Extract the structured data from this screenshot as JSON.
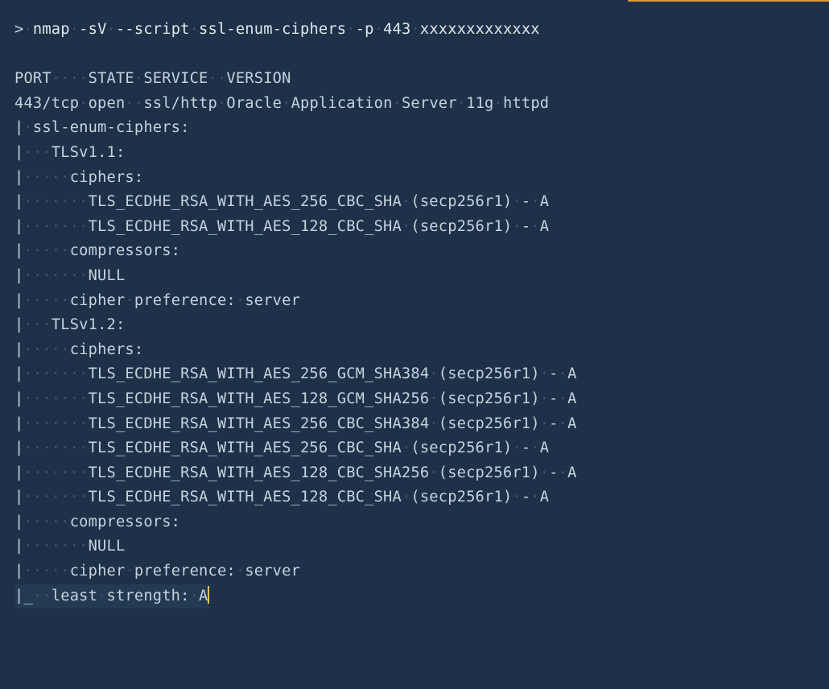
{
  "terminal": {
    "prompt": ">",
    "command": "nmap -sV --script ssl-enum-ciphers -p 443 xxxxxxxxxxxxx",
    "header": "PORT    STATE SERVICE  VERSION",
    "port_line": "443/tcp open  ssl/http Oracle Application Server 11g httpd",
    "script_name": "ssl-enum-ciphers:",
    "tls11": {
      "label": "TLSv1.1:",
      "ciphers_label": "ciphers:",
      "ciphers": [
        "TLS_ECDHE_RSA_WITH_AES_256_CBC_SHA (secp256r1) - A",
        "TLS_ECDHE_RSA_WITH_AES_128_CBC_SHA (secp256r1) - A"
      ],
      "compressors_label": "compressors:",
      "compressors": [
        "NULL"
      ],
      "pref_label": "cipher preference:",
      "pref_value": "server"
    },
    "tls12": {
      "label": "TLSv1.2:",
      "ciphers_label": "ciphers:",
      "ciphers": [
        "TLS_ECDHE_RSA_WITH_AES_256_GCM_SHA384 (secp256r1) - A",
        "TLS_ECDHE_RSA_WITH_AES_128_GCM_SHA256 (secp256r1) - A",
        "TLS_ECDHE_RSA_WITH_AES_256_CBC_SHA384 (secp256r1) - A",
        "TLS_ECDHE_RSA_WITH_AES_256_CBC_SHA (secp256r1) - A",
        "TLS_ECDHE_RSA_WITH_AES_128_CBC_SHA256 (secp256r1) - A",
        "TLS_ECDHE_RSA_WITH_AES_128_CBC_SHA (secp256r1) - A"
      ],
      "compressors_label": "compressors:",
      "compressors": [
        "NULL"
      ],
      "pref_label": "cipher preference:",
      "pref_value": "server"
    },
    "least_label": "least strength:",
    "least_value": "A"
  },
  "glyphs": {
    "dot": "·",
    "pipe": "|",
    "end": "|_"
  }
}
